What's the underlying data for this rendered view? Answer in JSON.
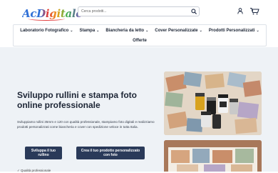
{
  "header": {
    "logo_text": "AcDigitale",
    "search": {
      "placeholder": "Cerca prodotti..."
    },
    "cart": {
      "count": "0"
    }
  },
  "nav": {
    "row1": [
      {
        "label": "Laboratorio Fotografico"
      },
      {
        "label": "Stampa"
      },
      {
        "label": "Biancheria da letto"
      },
      {
        "label": "Cover Personalizzate"
      },
      {
        "label": "Prodotti Personalizzati"
      }
    ],
    "row2": [
      {
        "label": "Offerte"
      }
    ]
  },
  "hero": {
    "title": "Sviluppo rullini e stampa foto online professionale",
    "description": "Sviluppiamo rullini 35mm e 120 con qualità professionale, stampiamo foto digitali e realizziamo prodotti personalizzati come biancheria e cover con spedizione veloce in tutta Italia.",
    "button1": "Sviluppa il tuo rullino",
    "button2": "Crea il tuo prodotto personalizzato con foto",
    "note": "✓ Qualità professionale"
  },
  "colors": {
    "primary_button": "#2a3a59",
    "hero_background": "#eef2f6",
    "text": "#1c2535"
  }
}
